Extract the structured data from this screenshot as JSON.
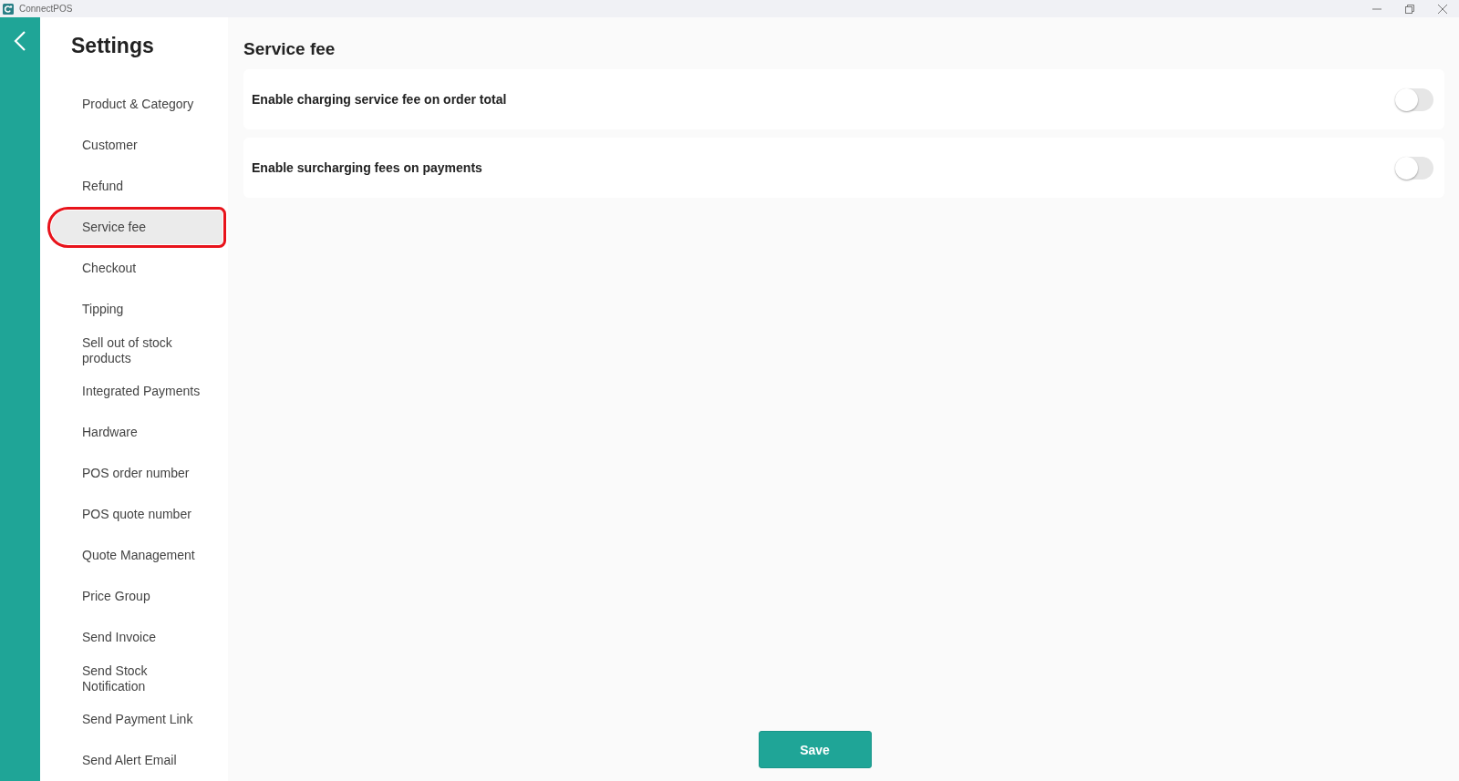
{
  "window": {
    "title": "ConnectPOS"
  },
  "sidebar": {
    "title": "Settings",
    "items": [
      {
        "label": "Product & Category",
        "selected": false
      },
      {
        "label": "Customer",
        "selected": false
      },
      {
        "label": "Refund",
        "selected": false
      },
      {
        "label": "Service fee",
        "selected": true
      },
      {
        "label": "Checkout",
        "selected": false
      },
      {
        "label": "Tipping",
        "selected": false
      },
      {
        "label": "Sell out of stock products",
        "selected": false
      },
      {
        "label": "Integrated Payments",
        "selected": false
      },
      {
        "label": "Hardware",
        "selected": false
      },
      {
        "label": "POS order number",
        "selected": false
      },
      {
        "label": "POS quote number",
        "selected": false
      },
      {
        "label": "Quote Management",
        "selected": false
      },
      {
        "label": "Price Group",
        "selected": false
      },
      {
        "label": "Send Invoice",
        "selected": false
      },
      {
        "label": "Send Stock Notification",
        "selected": false
      },
      {
        "label": "Send Payment Link",
        "selected": false
      },
      {
        "label": "Send Alert Email",
        "selected": false
      }
    ]
  },
  "content": {
    "title": "Service fee",
    "settings": [
      {
        "label": "Enable charging service fee on order total",
        "on": false
      },
      {
        "label": "Enable surcharging fees on payments",
        "on": false
      }
    ]
  },
  "save_button": "Save"
}
